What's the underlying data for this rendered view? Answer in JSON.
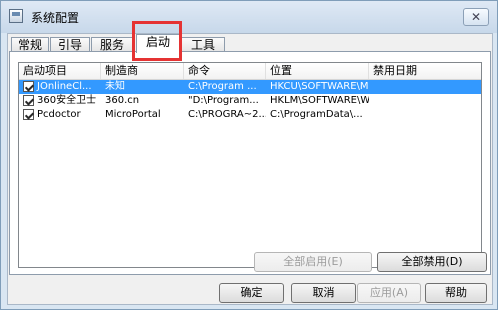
{
  "window": {
    "title": "系统配置",
    "close_glyph": "✕"
  },
  "tabs": [
    {
      "label": "常规"
    },
    {
      "label": "引导"
    },
    {
      "label": "服务"
    },
    {
      "label": "启动",
      "active": true
    },
    {
      "label": "工具"
    }
  ],
  "startup_list": {
    "columns": [
      "启动项目",
      "制造商",
      "命令",
      "位置",
      "禁用日期"
    ],
    "rows": [
      {
        "checked": true,
        "item": "JOnlineCl...",
        "maker": "未知",
        "command": "C:\\Program ...",
        "location": "HKCU\\SOFTWARE\\M...",
        "disabled_date": "",
        "selected": true
      },
      {
        "checked": true,
        "item": "360安全卫士",
        "maker": "360.cn",
        "command": "\"D:\\Program...",
        "location": "HKLM\\SOFTWARE\\W...",
        "disabled_date": ""
      },
      {
        "checked": true,
        "item": "Pcdoctor",
        "maker": "MicroPortal",
        "command": "C:\\PROGRA~2...",
        "location": "C:\\ProgramData\\...",
        "disabled_date": ""
      }
    ]
  },
  "buttons": {
    "enable_all": "全部启用(E)",
    "disable_all": "全部禁用(D)",
    "ok": "确定",
    "cancel": "取消",
    "apply": "应用(A)",
    "help": "帮助"
  },
  "colors": {
    "selection": "#3399ff",
    "highlight_box": "#e53333"
  }
}
